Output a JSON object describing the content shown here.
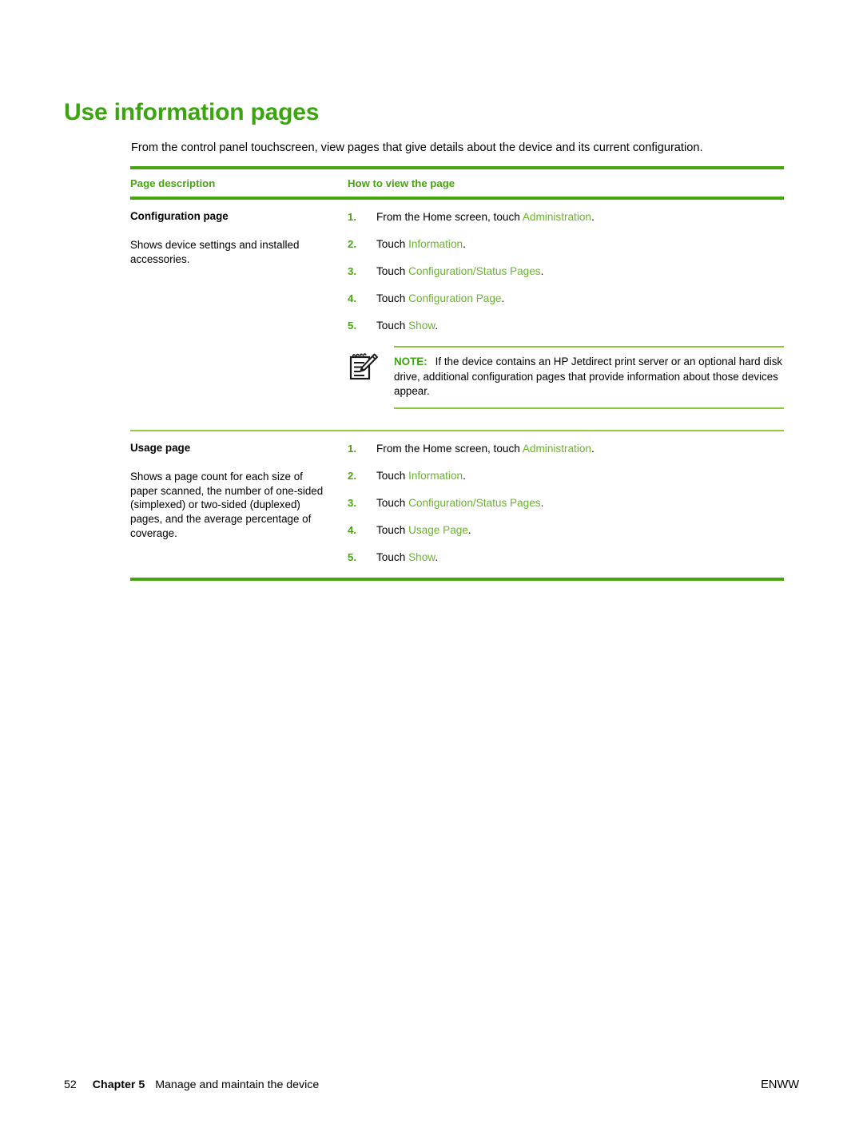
{
  "heading": "Use information pages",
  "intro": "From the control panel touchscreen, view pages that give details about the device and its current configuration.",
  "colors": {
    "heading_green": "#3ba50f",
    "rule_green": "#47a510",
    "ui_term_green": "#69b52a",
    "thin_rule_green": "#96c93d"
  },
  "table": {
    "headers": {
      "col1": "Page description",
      "col2": "How to view the page"
    },
    "rows": [
      {
        "title": "Configuration page",
        "description": "Shows device settings and installed accessories.",
        "steps": [
          {
            "num": "1.",
            "pre": "From the Home screen, touch ",
            "ui": "Administration",
            "post": "."
          },
          {
            "num": "2.",
            "pre": "Touch ",
            "ui": "Information",
            "post": "."
          },
          {
            "num": "3.",
            "pre": "Touch ",
            "ui": "Configuration/Status Pages",
            "post": "."
          },
          {
            "num": "4.",
            "pre": "Touch ",
            "ui": "Configuration Page",
            "post": "."
          },
          {
            "num": "5.",
            "pre": "Touch ",
            "ui": "Show",
            "post": "."
          }
        ],
        "note": {
          "icon": "note-pad-pencil-icon",
          "label": "NOTE:",
          "text": "If the device contains an HP Jetdirect print server or an optional hard disk drive, additional configuration pages that provide information about those devices appear."
        }
      },
      {
        "title": "Usage page",
        "description": "Shows a page count for each size of paper scanned, the number of one-sided (simplexed) or two-sided (duplexed) pages, and the average percentage of coverage.",
        "steps": [
          {
            "num": "1.",
            "pre": "From the Home screen, touch ",
            "ui": "Administration",
            "post": "."
          },
          {
            "num": "2.",
            "pre": "Touch ",
            "ui": "Information",
            "post": "."
          },
          {
            "num": "3.",
            "pre": "Touch ",
            "ui": "Configuration/Status Pages",
            "post": "."
          },
          {
            "num": "4.",
            "pre": "Touch ",
            "ui": "Usage Page",
            "post": "."
          },
          {
            "num": "5.",
            "pre": "Touch ",
            "ui": "Show",
            "post": "."
          }
        ],
        "note": null
      }
    ]
  },
  "footer": {
    "page_number": "52",
    "chapter": "Chapter 5",
    "chapter_title": "Manage and maintain the device",
    "locale": "ENWW"
  }
}
